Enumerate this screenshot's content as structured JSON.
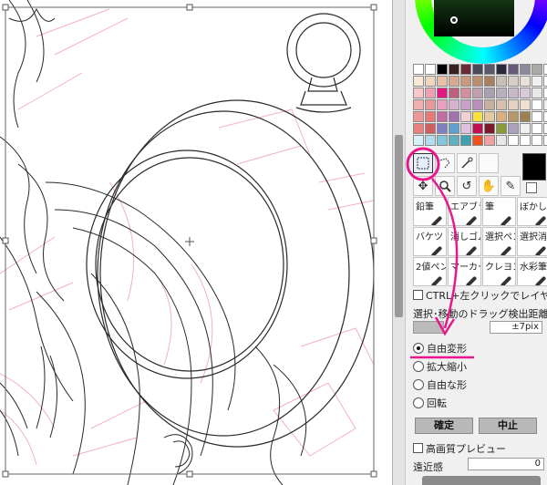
{
  "brushes": [
    {
      "label": "鉛筆"
    },
    {
      "label": "エアブラシ"
    },
    {
      "label": "筆"
    },
    {
      "label": "ぼかし"
    },
    {
      "label": "バケツ"
    },
    {
      "label": "消しゴム"
    },
    {
      "label": "選択ペン"
    },
    {
      "label": "選択消"
    },
    {
      "label": "2値ペン"
    },
    {
      "label": "マーカー"
    },
    {
      "label": "クレヨン"
    },
    {
      "label": "水彩筆"
    }
  ],
  "options": {
    "ctrl_click_layer": "CTRL+左クリックでレイヤー選",
    "drag_distance_label": "選択･移動のドラッグ検出距離",
    "drag_distance_value": "±7pix",
    "transform_modes": [
      "自由変形",
      "拡大縮小",
      "自由な形",
      "回転"
    ],
    "selected_mode": "自由変形",
    "confirm_button": "確定",
    "cancel_button": "中止",
    "hq_preview": "高画質プレビュー",
    "near_label": "遠近感",
    "near_value": "0"
  },
  "colors": {
    "accent_annotation": "#e8188c",
    "foreground": "#000000"
  },
  "palette": [
    "#ffffff",
    "#ffffff",
    "#000000",
    "#3a2020",
    "#6a2a3a",
    "#4a4a5a",
    "#5a5a6a",
    "#2a2a3a",
    "#6a5a7a",
    "#8a8a9a",
    "#aaaaaa",
    "#ffffff",
    "#f8e8d8",
    "#f0d8c0",
    "#e8c0a8",
    "#d8a890",
    "#c89880",
    "#b89070",
    "#a88060",
    "#c8c0b8",
    "#d8d0c8",
    "#e8e0d8",
    "#f0f0f0",
    "#ffffff",
    "#f8c8c8",
    "#f0a0b0",
    "#e01880",
    "#c06080",
    "#d090a0",
    "#c0a0b0",
    "#a8a0b0",
    "#b8b0c0",
    "#c8b8c8",
    "#d8c8d8",
    "#e8e8e8",
    "#ffffff",
    "#f0b0b0",
    "#e89898",
    "#e8a0c0",
    "#d8b0d0",
    "#c8a0c8",
    "#b890b8",
    "#c8b0a0",
    "#d8c0b0",
    "#e8d0c0",
    "#f0e0d0",
    "#ffffff",
    "#f0f0f0",
    "#f09898",
    "#e87878",
    "#c070a0",
    "#a070b0",
    "#f0d0d0",
    "#f8e040",
    "#e8c8a0",
    "#d8b080",
    "#b89868",
    "#a08050",
    "#ffffff",
    "#ffffff",
    "#e88080",
    "#d06060",
    "#8080c0",
    "#60a0d0",
    "#e0c0e0",
    "#c01050",
    "#7a1a2a",
    "#8a9a3a",
    "#b0a0c0",
    "#f0f0f0",
    "#ffffff",
    "#ffffff",
    "#d8f0f8",
    "#b0e0f0",
    "#80c8d8",
    "#60b0c0",
    "#40a0b0",
    "#f05020",
    "#f0a0a0",
    "#e8e8e8",
    "#ffffff",
    "#ffffff",
    "#ffffff",
    "#ffffff"
  ]
}
